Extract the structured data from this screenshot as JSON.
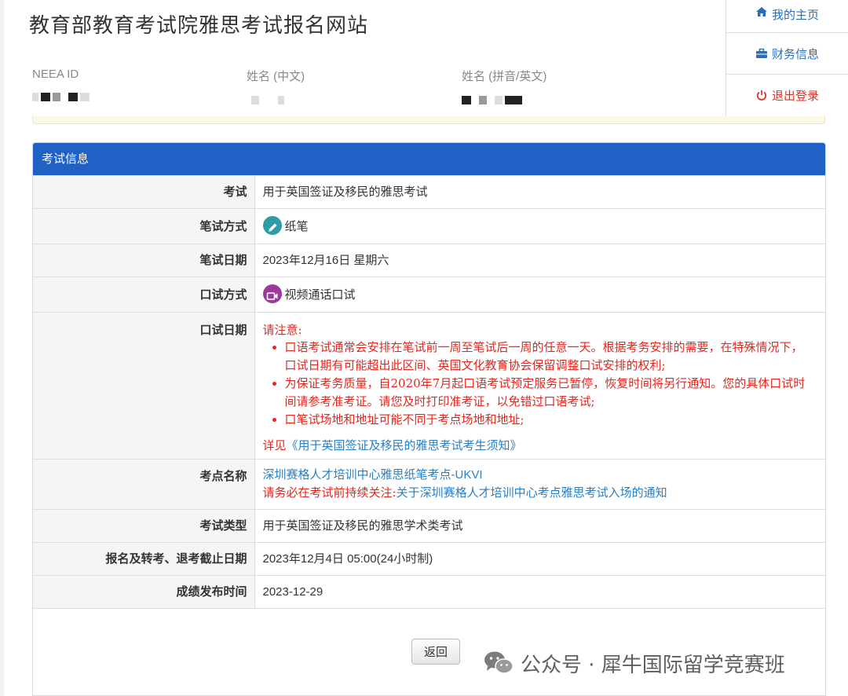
{
  "header": {
    "site_title": "教育部教育考试院雅思考试报名网站",
    "neea_label": "NEEA ID",
    "name_cn_label": "姓名 (中文)",
    "name_en_label": "姓名 (拼音/英文)"
  },
  "nav": {
    "home": "我的主页",
    "finance": "财务信息",
    "logout": "退出登录"
  },
  "panel": {
    "title": "考试信息",
    "rows": {
      "exam": {
        "label": "考试",
        "value": "用于英国签证及移民的雅思考试"
      },
      "written_mode": {
        "label": "笔试方式",
        "value": "纸笔"
      },
      "written_date": {
        "label": "笔试日期",
        "value": "2023年12月16日 星期六"
      },
      "oral_mode": {
        "label": "口试方式",
        "value": "视频通话口试"
      },
      "oral_date": {
        "label": "口试日期",
        "notice_title": "请注意:",
        "notes": [
          "口语考试通常会安排在笔试前一周至笔试后一周的任意一天。根据考务安排的需要，在特殊情况下，口试日期有可能超出此区间、英国文化教育协会保留调整口试安排的权利;",
          "为保证考务质量，自2020年7月起口语考试预定服务已暂停，恢复时间将另行通知。您的具体口试时间请参考准考证。请您及时打印准考证，以免错过口语考试;",
          "口笔试场地和地址可能不同于考点场地和地址;"
        ],
        "detail_prefix": "详见",
        "detail_link": "《用于英国签证及移民的雅思考试考生须知》"
      },
      "center": {
        "label": "考点名称",
        "link": "深圳赛格人才培训中心雅思纸笔考点-UKVI",
        "notice_prefix": "请务必在考试前持续关注:",
        "notice_link": "关于深圳赛格人才培训中心考点雅思考试入场的通知"
      },
      "exam_type": {
        "label": "考试类型",
        "value": "用于英国签证及移民的雅思学术类考试"
      },
      "deadline": {
        "label": "报名及转考、退考截止日期",
        "value": "2023年12月4日 05:00(24小时制)"
      },
      "result_date": {
        "label": "成绩发布时间",
        "value": "2023-12-29"
      }
    },
    "back_label": "返回"
  },
  "watermark": "公众号 · 犀牛国际留学竞赛班",
  "colors": {
    "panel_header": "#2160c4",
    "link": "#2a7fc2",
    "alert": "#e0281f",
    "logout": "#d9342b"
  },
  "icons": {
    "home": "home-icon",
    "finance": "briefcase-icon",
    "logout": "power-icon",
    "pencil": "pencil-icon",
    "video": "video-camera-icon",
    "wechat": "wechat-icon"
  }
}
